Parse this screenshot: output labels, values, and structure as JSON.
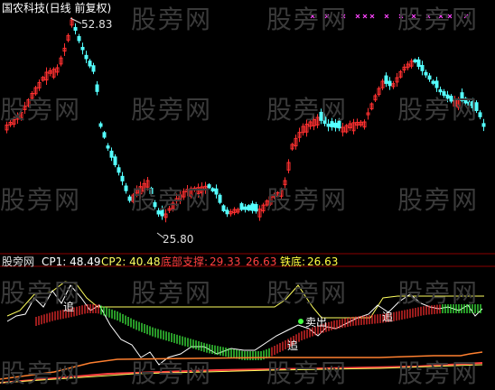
{
  "header": {
    "title": "国农科技(日线 前复权)",
    "title_color": "#ffffff"
  },
  "price_panel": {
    "high_label": "52.83",
    "low_label": "25.80",
    "up_color": "#ff3030",
    "down_color": "#54ffff",
    "marker_color": "#ff44ff"
  },
  "indicator_panel": {
    "name": "股旁网",
    "cp1": "CP1: 48.49",
    "cp2": "CP2: 40.48",
    "support_label": "底部支撑:",
    "support_value1": "29.33",
    "support_value2": "26.63",
    "iron_label": "铁底:",
    "iron_value": "26.63",
    "annotations": [
      "追",
      "追",
      "追",
      "卖出"
    ],
    "colors": {
      "cp1": "#ffffff",
      "cp2": "#ffff60",
      "support": "#ff4040",
      "iron": "#ffff40"
    }
  },
  "watermark": "股旁网",
  "chart_data": {
    "type": "candlestick",
    "title": "国农科技(日线 前复权)",
    "high": 52.83,
    "low": 25.8,
    "indicator": {
      "CP1": 48.49,
      "CP2": 40.48,
      "底部支撑": [
        29.33,
        26.63
      ],
      "铁底": 26.63
    }
  }
}
